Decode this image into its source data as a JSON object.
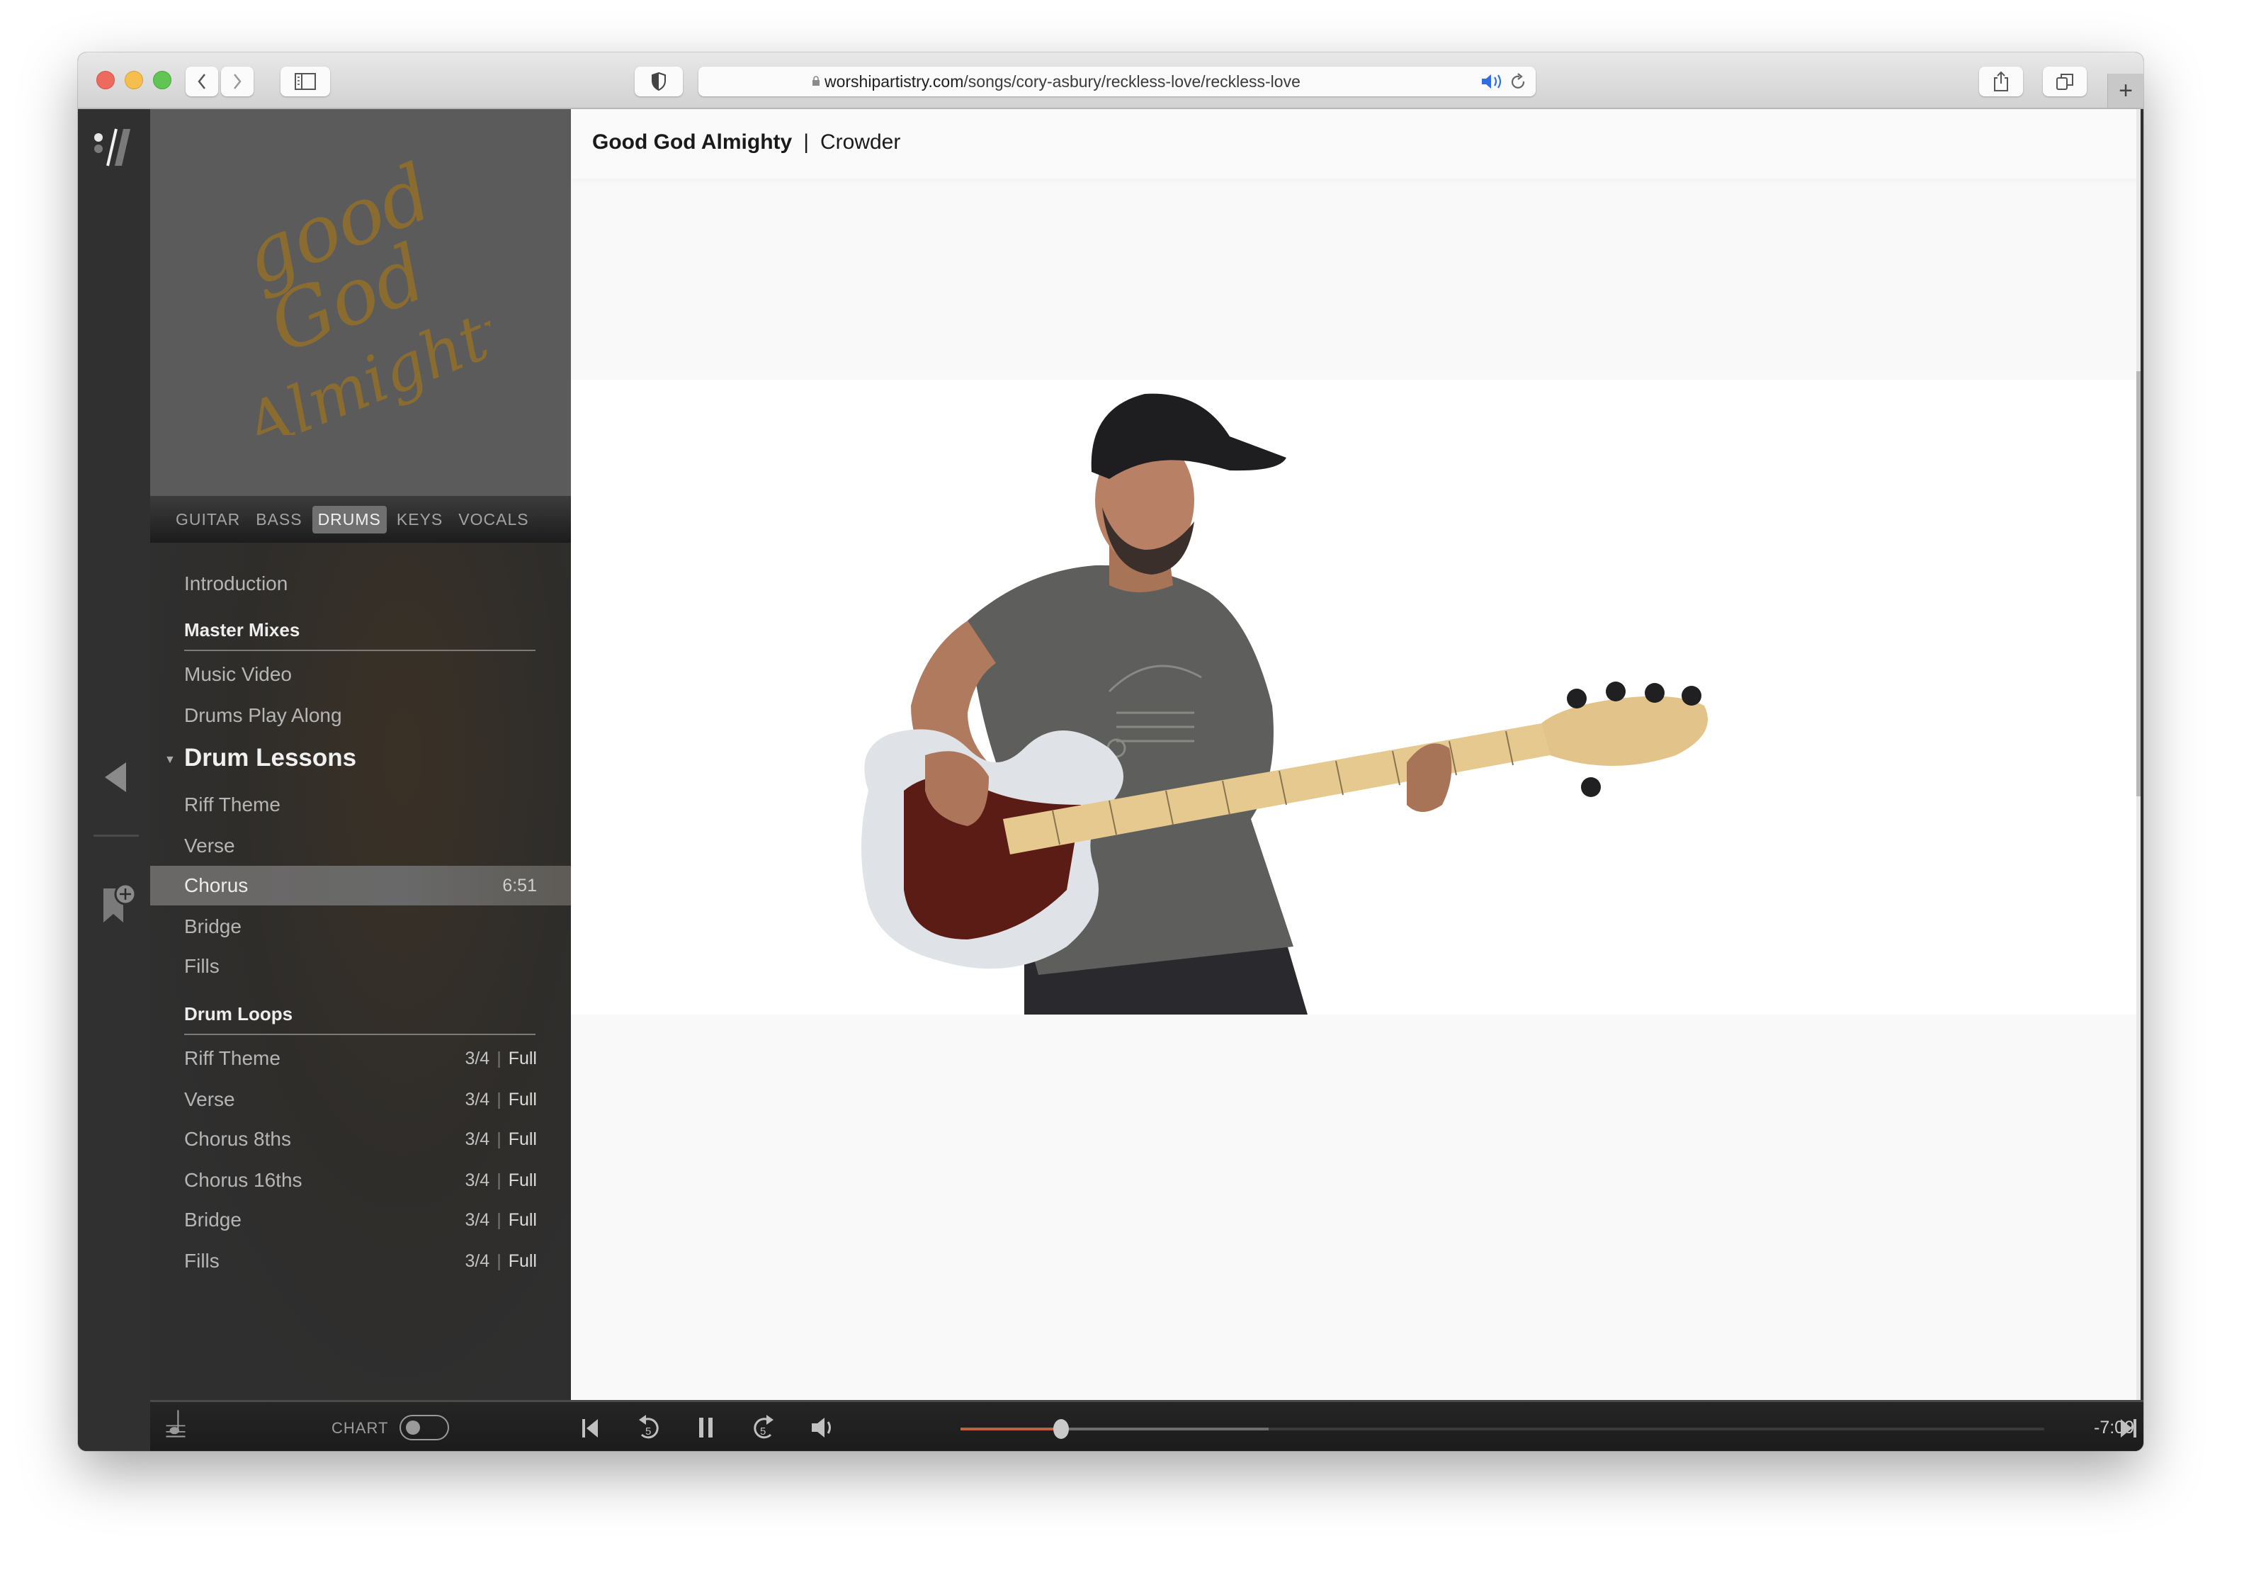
{
  "browser": {
    "url_host": "worshipartistry.com",
    "url_path": "/songs/cory-asbury/reckless-love/reckless-love",
    "icons": {
      "back": "chevron-left-icon",
      "forward": "chevron-right-icon",
      "sidebar": "sidebar-icon",
      "privacy": "shield-icon",
      "lock": "lock-icon",
      "audio": "speaker-icon",
      "reload": "reload-icon",
      "share": "share-icon",
      "tabs": "tabs-overview-icon",
      "new_tab": "plus-icon"
    },
    "new_tab_label": "+"
  },
  "rail": {
    "logo": "worship-artistry-logo",
    "collapse_icon": "triangle-left-icon",
    "bookmark_icon": "bookmark-add-icon"
  },
  "album": {
    "art_lines": [
      "good",
      "God",
      "Almighty"
    ]
  },
  "instrument_tabs": [
    {
      "label": "GUITAR",
      "active": false
    },
    {
      "label": "BASS",
      "active": false
    },
    {
      "label": "DRUMS",
      "active": true
    },
    {
      "label": "KEYS",
      "active": false
    },
    {
      "label": "VOCALS",
      "active": false
    }
  ],
  "lesson_list": {
    "introduction": "Introduction",
    "master_mixes": {
      "heading": "Master Mixes",
      "items": [
        "Music Video",
        "Drums Play Along"
      ]
    },
    "drum_lessons": {
      "heading": "Drum Lessons",
      "expanded": true,
      "items": [
        {
          "label": "Riff Theme",
          "duration": ""
        },
        {
          "label": "Verse",
          "duration": ""
        },
        {
          "label": "Chorus",
          "duration": "6:51",
          "active": true
        },
        {
          "label": "Bridge",
          "duration": ""
        },
        {
          "label": "Fills",
          "duration": ""
        }
      ]
    },
    "drum_loops": {
      "heading": "Drum Loops",
      "items": [
        {
          "label": "Riff Theme",
          "speed": "3/4",
          "full": "Full"
        },
        {
          "label": "Verse",
          "speed": "3/4",
          "full": "Full"
        },
        {
          "label": "Chorus 8ths",
          "speed": "3/4",
          "full": "Full"
        },
        {
          "label": "Chorus 16ths",
          "speed": "3/4",
          "full": "Full"
        },
        {
          "label": "Bridge",
          "speed": "3/4",
          "full": "Full"
        },
        {
          "label": "Fills",
          "speed": "3/4",
          "full": "Full"
        }
      ]
    }
  },
  "header": {
    "song": "Good God Almighty",
    "separator": "|",
    "artist": "Crowder"
  },
  "video": {
    "description": "Man in black cap and grey t-shirt playing a white five-string bass guitar"
  },
  "player": {
    "notation_icon": "music-note-icon",
    "chart_label": "CHART",
    "chart_toggle_on": false,
    "prev_icon": "skip-back-icon",
    "rewind_icon": "rewind-5-icon",
    "rewind_seconds": "5",
    "pause_icon": "pause-icon",
    "forward_icon": "forward-5-icon",
    "forward_seconds": "5",
    "volume_icon": "volume-icon",
    "progress_played_pct": 9.3,
    "progress_buffered_pct": 28.4,
    "remaining_time": "-7:09",
    "next_icon": "skip-forward-icon",
    "accent_color": "#b9643c"
  }
}
